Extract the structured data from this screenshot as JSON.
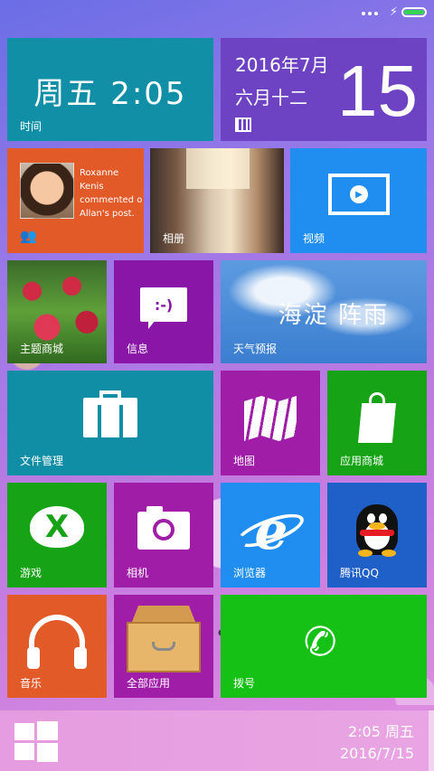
{
  "status_bar": {
    "signal_icon": "three-dots",
    "charging_icon": "lightning",
    "battery_icon": "battery-green",
    "battery_color": "#39d353"
  },
  "tiles": {
    "clock": {
      "text": "周五  2:05",
      "label": "时间"
    },
    "date": {
      "year_month": "2016年7月",
      "lunar": "六月十二",
      "day": "15"
    },
    "people": {
      "text": "Roxanne Kenis commented o Allan's post."
    },
    "album": {
      "label": "相册"
    },
    "video": {
      "label": "视频"
    },
    "theme_store": {
      "label": "主题商城"
    },
    "messages": {
      "label": "信息",
      "emoticon": ":-)"
    },
    "weather": {
      "text": "海淀  阵雨",
      "label": "天气预报"
    },
    "file_manager": {
      "label": "文件管理"
    },
    "maps": {
      "label": "地图"
    },
    "app_store": {
      "label": "应用商城"
    },
    "games": {
      "label": "游戏",
      "glyph": "X"
    },
    "camera": {
      "label": "相机"
    },
    "browser": {
      "label": "浏览器",
      "glyph": "e"
    },
    "qq": {
      "label": "腾讯QQ"
    },
    "music": {
      "label": "音乐"
    },
    "all_apps": {
      "label": "全部应用"
    },
    "dialer": {
      "label": "拨号",
      "glyph": "✆"
    }
  },
  "taskbar": {
    "time": "2:05 周五",
    "date": "2016/7/15"
  },
  "colors": {
    "teal": "#108fa6",
    "purple": "#6d43c3",
    "orange": "#e35a29",
    "blue": "#1f8ef0",
    "magenta": "#a01da8",
    "green": "#16a316",
    "bright_green": "#16c116",
    "qq_blue": "#1f60c8"
  }
}
